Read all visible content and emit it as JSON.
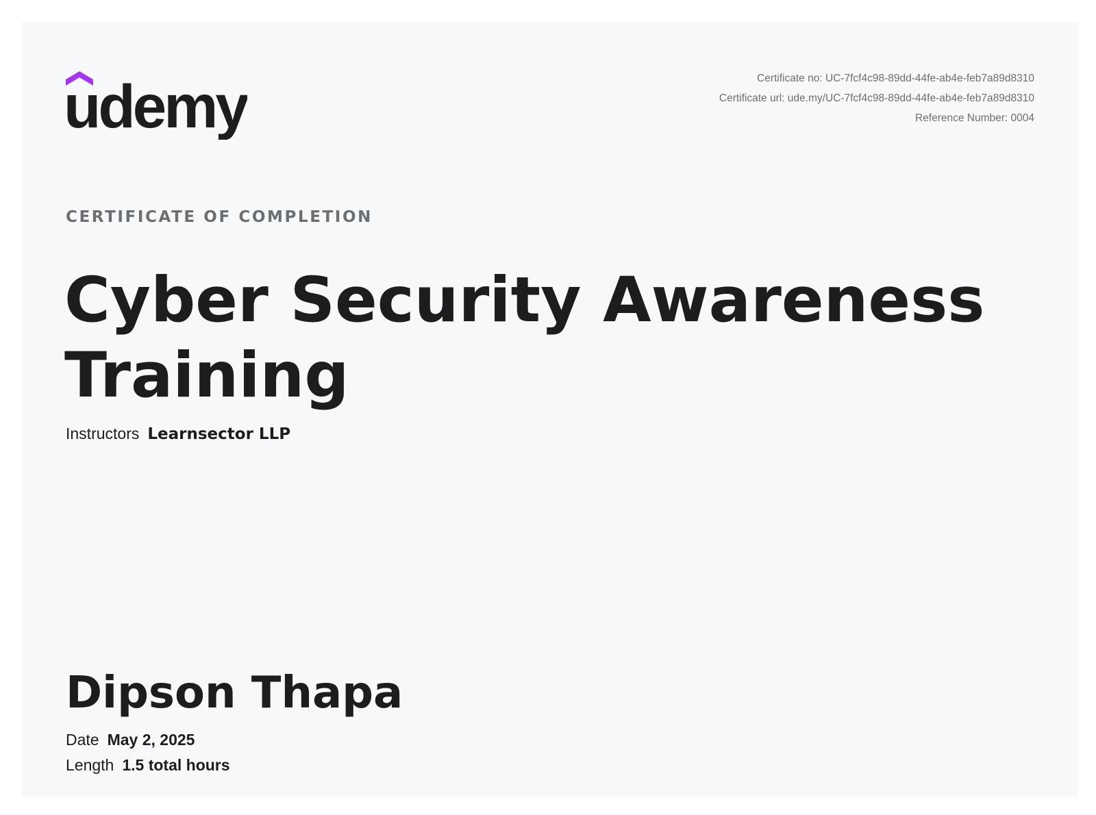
{
  "brand": {
    "name": "udemy",
    "accent_color": "#a435f0",
    "text_color": "#1c1d1f"
  },
  "meta": {
    "certificate_no": "Certificate no: UC-7fcf4c98-89dd-44fe-ab4e-feb7a89d8310",
    "certificate_url": "Certificate url: ude.my/UC-7fcf4c98-89dd-44fe-ab4e-feb7a89d8310",
    "reference_number": "Reference Number: 0004"
  },
  "certificate": {
    "eyebrow": "CERTIFICATE OF COMPLETION",
    "course_title": "Cyber Security Awareness Training",
    "instructors_label": "Instructors",
    "instructors_value": "Learnsector LLP",
    "student_name": "Dipson Thapa",
    "date_label": "Date",
    "date_value": "May 2, 2025",
    "length_label": "Length",
    "length_value": "1.5 total hours"
  }
}
